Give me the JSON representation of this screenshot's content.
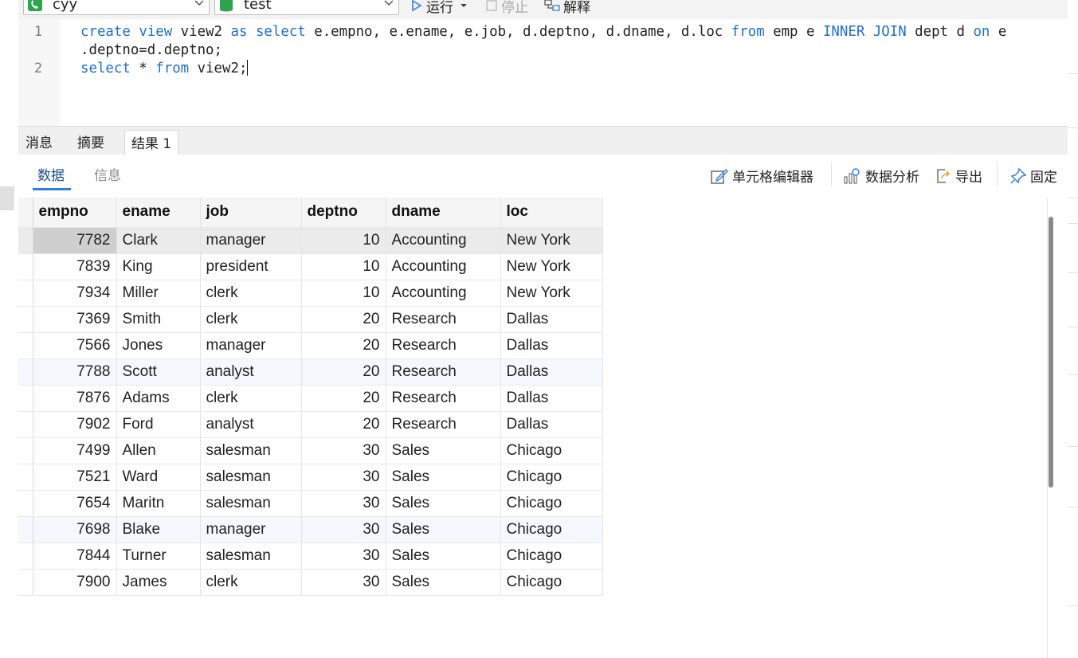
{
  "toolbar": {
    "connection": "cyy",
    "database": "test",
    "run_label": "运行",
    "stop_label": "停止",
    "explain_label": "解释"
  },
  "editor": {
    "line_numbers": [
      "1",
      "2"
    ],
    "lines": [
      [
        {
          "t": "create",
          "k": true
        },
        {
          "t": " "
        },
        {
          "t": "view",
          "k": true
        },
        {
          "t": " view2 "
        },
        {
          "t": "as",
          "k": true
        },
        {
          "t": " "
        },
        {
          "t": "select",
          "k": true
        },
        {
          "t": " e.empno, e.ename, e.job, d.deptno, d.dname, d.loc "
        },
        {
          "t": "from",
          "k": true
        },
        {
          "t": " emp e "
        },
        {
          "t": "INNER",
          "k": true
        },
        {
          "t": " "
        },
        {
          "t": "JOIN",
          "k": true
        },
        {
          "t": " dept d "
        },
        {
          "t": "on",
          "k": true
        },
        {
          "t": " e"
        }
      ],
      [
        {
          "t": ".deptno=d.deptno;"
        }
      ],
      [
        {
          "t": "select",
          "k": true
        },
        {
          "t": " * "
        },
        {
          "t": "from",
          "k": true
        },
        {
          "t": " view2;"
        }
      ]
    ]
  },
  "tabs": {
    "messages": "消息",
    "summary": "摘要",
    "result1": "结果 1"
  },
  "subbar": {
    "data_tab": "数据",
    "info_tab": "信息",
    "cell_editor": "单元格编辑器",
    "data_analysis": "数据分析",
    "export": "导出",
    "pin": "固定"
  },
  "table": {
    "columns": [
      "empno",
      "ename",
      "job",
      "deptno",
      "dname",
      "loc"
    ],
    "rows": [
      [
        "7782",
        "Clark",
        "manager",
        "10",
        "Accounting",
        "New York"
      ],
      [
        "7839",
        "King",
        "president",
        "10",
        "Accounting",
        "New York"
      ],
      [
        "7934",
        "Miller",
        "clerk",
        "10",
        "Accounting",
        "New York"
      ],
      [
        "7369",
        "Smith",
        "clerk",
        "20",
        "Research",
        "Dallas"
      ],
      [
        "7566",
        "Jones",
        "manager",
        "20",
        "Research",
        "Dallas"
      ],
      [
        "7788",
        "Scott",
        "analyst",
        "20",
        "Research",
        "Dallas"
      ],
      [
        "7876",
        "Adams",
        "clerk",
        "20",
        "Research",
        "Dallas"
      ],
      [
        "7902",
        "Ford",
        "analyst",
        "20",
        "Research",
        "Dallas"
      ],
      [
        "7499",
        "Allen",
        "salesman",
        "30",
        "Sales",
        "Chicago"
      ],
      [
        "7521",
        "Ward",
        "salesman",
        "30",
        "Sales",
        "Chicago"
      ],
      [
        "7654",
        "Maritn",
        "salesman",
        "30",
        "Sales",
        "Chicago"
      ],
      [
        "7698",
        "Blake",
        "manager",
        "30",
        "Sales",
        "Chicago"
      ],
      [
        "7844",
        "Turner",
        "salesman",
        "30",
        "Sales",
        "Chicago"
      ],
      [
        "7900",
        "James",
        "clerk",
        "30",
        "Sales",
        "Chicago"
      ]
    ],
    "selected_row": 0,
    "highlighted_rows": [
      5,
      11
    ]
  },
  "colors": {
    "keyword": "#1d6fd6",
    "accent": "#2f7fe0",
    "connection_icon": "#2ea44f",
    "database_icon": "#2ea44f"
  }
}
